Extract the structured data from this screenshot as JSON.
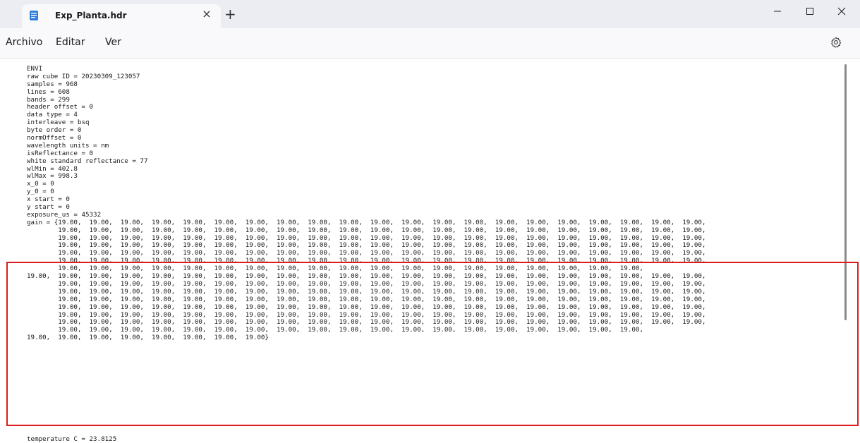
{
  "window": {
    "tab_title": "Exp_Planta.hdr",
    "new_tab_symbol": "+",
    "close_tab_symbol": "×",
    "icons": {
      "file": "notepad-icon",
      "settings": "gear-icon"
    }
  },
  "menu": {
    "archivo": "Archivo",
    "editar": "Editar",
    "ver": "Ver"
  },
  "editor": {
    "lines": [
      "ENVI",
      "raw cube ID = 20230309_123057",
      "samples = 968",
      "lines = 608",
      "bands = 299",
      "header offset = 0",
      "data type = 4",
      "interleave = bsq",
      "byte order = 0",
      "normOffset = 0",
      "wavelength units = nm",
      "isReflectance = 0",
      "white standard reflectance = 77",
      "wlMin = 402.8",
      "wlMax = 998.3",
      "x_0 = 0",
      "y_0 = 0",
      "x start = 0",
      "y start = 0",
      "exposure_us = 45332",
      "gain = {19.00,  19.00,  19.00,  19.00,  19.00,  19.00,  19.00,  19.00,  19.00,  19.00,  19.00,  19.00,  19.00,  19.00,  19.00,  19.00,  19.00,  19.00,  19.00,  19.00,  19.00,",
      "        19.00,  19.00,  19.00,  19.00,  19.00,  19.00,  19.00,  19.00,  19.00,  19.00,  19.00,  19.00,  19.00,  19.00,  19.00,  19.00,  19.00,  19.00,  19.00,  19.00,  19.00,",
      "        19.00,  19.00,  19.00,  19.00,  19.00,  19.00,  19.00,  19.00,  19.00,  19.00,  19.00,  19.00,  19.00,  19.00,  19.00,  19.00,  19.00,  19.00,  19.00,  19.00,  19.00,",
      "        19.00,  19.00,  19.00,  19.00,  19.00,  19.00,  19.00,  19.00,  19.00,  19.00,  19.00,  19.00,  19.00,  19.00,  19.00,  19.00,  19.00,  19.00,  19.00,  19.00,  19.00,",
      "        19.00,  19.00,  19.00,  19.00,  19.00,  19.00,  19.00,  19.00,  19.00,  19.00,  19.00,  19.00,  19.00,  19.00,  19.00,  19.00,  19.00,  19.00,  19.00,  19.00,  19.00,",
      "        19.00,  19.00,  19.00,  19.00,  19.00,  19.00,  19.00,  19.00,  19.00,  19.00,  19.00,  19.00,  19.00,  19.00,  19.00,  19.00,  19.00,  19.00,  19.00,  19.00,  19.00,",
      "        19.00,  19.00,  19.00,  19.00,  19.00,  19.00,  19.00,  19.00,  19.00,  19.00,  19.00,  19.00,  19.00,  19.00,  19.00,  19.00,  19.00,  19.00,  19.00,",
      "19.00,  19.00,  19.00,  19.00,  19.00,  19.00,  19.00,  19.00,  19.00,  19.00,  19.00,  19.00,  19.00,  19.00,  19.00,  19.00,  19.00,  19.00,  19.00,  19.00,  19.00,  19.00,",
      "        19.00,  19.00,  19.00,  19.00,  19.00,  19.00,  19.00,  19.00,  19.00,  19.00,  19.00,  19.00,  19.00,  19.00,  19.00,  19.00,  19.00,  19.00,  19.00,  19.00,  19.00,",
      "        19.00,  19.00,  19.00,  19.00,  19.00,  19.00,  19.00,  19.00,  19.00,  19.00,  19.00,  19.00,  19.00,  19.00,  19.00,  19.00,  19.00,  19.00,  19.00,  19.00,  19.00,",
      "        19.00,  19.00,  19.00,  19.00,  19.00,  19.00,  19.00,  19.00,  19.00,  19.00,  19.00,  19.00,  19.00,  19.00,  19.00,  19.00,  19.00,  19.00,  19.00,  19.00,  19.00,",
      "        19.00,  19.00,  19.00,  19.00,  19.00,  19.00,  19.00,  19.00,  19.00,  19.00,  19.00,  19.00,  19.00,  19.00,  19.00,  19.00,  19.00,  19.00,  19.00,  19.00,  19.00,",
      "        19.00,  19.00,  19.00,  19.00,  19.00,  19.00,  19.00,  19.00,  19.00,  19.00,  19.00,  19.00,  19.00,  19.00,  19.00,  19.00,  19.00,  19.00,  19.00,  19.00,  19.00,",
      "        19.00,  19.00,  19.00,  19.00,  19.00,  19.00,  19.00,  19.00,  19.00,  19.00,  19.00,  19.00,  19.00,  19.00,  19.00,  19.00,  19.00,  19.00,  19.00,  19.00,  19.00,",
      "        19.00,  19.00,  19.00,  19.00,  19.00,  19.00,  19.00,  19.00,  19.00,  19.00,  19.00,  19.00,  19.00,  19.00,  19.00,  19.00,  19.00,  19.00,  19.00,",
      "19.00,  19.00,  19.00,  19.00,  19.00,  19.00,  19.00,  19.00}"
    ],
    "temperature_line": "temperature C = 23.8125"
  },
  "colors": {
    "highlight_border": "#e01b1b",
    "titlebar_bg": "#ececf3",
    "tab_bg": "#f9f9fb",
    "notepad_icon": "#2f7fd9"
  }
}
